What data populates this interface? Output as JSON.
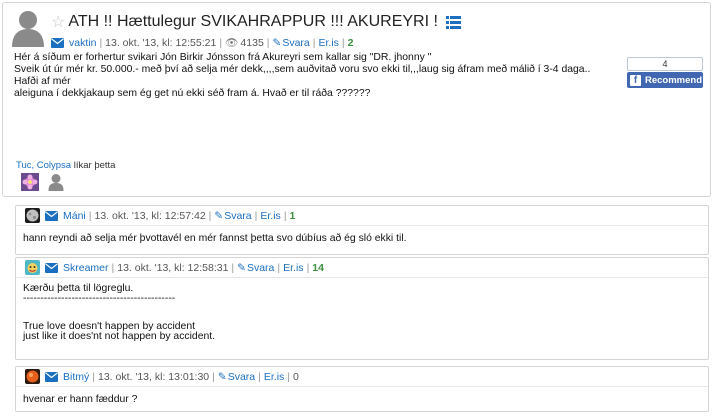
{
  "topic": {
    "title": "ATH !! Hættulegur SVIKAHRAPPUR !!! AKUREYRI !",
    "author": "vaktin",
    "date": "13. okt. '13, kl: 12:55:21",
    "views": "4135",
    "reply_label": "Svara",
    "eris_label": "Er.is",
    "reply_count": "2",
    "body": [
      "Hér á síðum er forhertur svikari Jón Birkir Jónsson frá Akureyri sem kallar sig \"DR. jhonny \"",
      "Sveik út úr mér kr. 50.000.- með því að selja mér dekk,,,,sem auðvitað voru svo ekki til,,,laug sig áfram með málið í 3-4 daga.. Hafði af mér",
      "aleiguna í dekkjakaup sem ég get nú ekki séð fram á. Hvað er til ráða ??????"
    ],
    "likers": "Tuc, Colypsa",
    "likes_suffix": "líkar þetta"
  },
  "facebook": {
    "count": "4",
    "button_label": "Recommend",
    "logo": "f"
  },
  "replies": [
    {
      "author": "Máni",
      "date": "13. okt. '13, kl: 12:57:42",
      "reply_label": "Svara",
      "eris_label": "Er.is",
      "count": "1",
      "lines": [
        "hann reyndi að selja mér þvottavél en mér fannst þetta svo dúbíus að ég sló ekki til."
      ]
    },
    {
      "author": "Skreamer",
      "date": "13. okt. '13, kl: 12:58:31",
      "reply_label": "Svara",
      "eris_label": "Er.is",
      "count": "14",
      "lines": [
        "Kærðu þetta til lögreglu.",
        "--------------------------------------------",
        "",
        "",
        "True love doesn't happen by accident",
        "just like it does'nt not happen by accident."
      ]
    },
    {
      "author": "Bitmý",
      "date": "13. okt. '13, kl: 13:01:30",
      "reply_label": "Svara",
      "eris_label": "Er.is",
      "count": "0",
      "lines": [
        "hvenar er hann fæddur ?"
      ]
    }
  ],
  "colors": {
    "link": "#1a6fc0",
    "count_green": "#3c8f3c",
    "facebook_blue": "#4267b2",
    "border": "#d4d4d4"
  },
  "icons": [
    "default-avatar-icon",
    "star-icon",
    "list-icon",
    "envelope-icon",
    "eye-icon",
    "pencil-icon",
    "facebook-logo-icon"
  ]
}
